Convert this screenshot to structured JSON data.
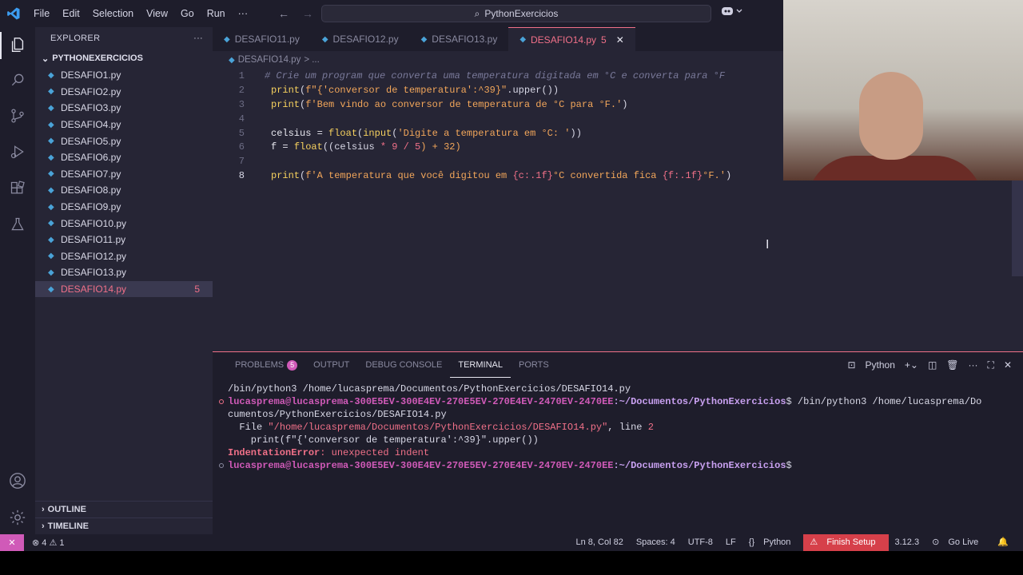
{
  "titlebar": {
    "menu": [
      "File",
      "Edit",
      "Selection",
      "View",
      "Go",
      "Run",
      "···"
    ],
    "search": "PythonExercicios"
  },
  "sidebar": {
    "title": "EXPLORER",
    "folder": "PYTHONEXERCICIOS",
    "files": [
      {
        "name": "DESAFIO1.py"
      },
      {
        "name": "DESAFIO2.py"
      },
      {
        "name": "DESAFIO3.py"
      },
      {
        "name": "DESAFIO4.py"
      },
      {
        "name": "DESAFIO5.py"
      },
      {
        "name": "DESAFIO6.py"
      },
      {
        "name": "DESAFIO7.py"
      },
      {
        "name": "DESAFIO8.py"
      },
      {
        "name": "DESAFIO9.py"
      },
      {
        "name": "DESAFIO10.py"
      },
      {
        "name": "DESAFIO11.py"
      },
      {
        "name": "DESAFIO12.py"
      },
      {
        "name": "DESAFIO13.py"
      },
      {
        "name": "DESAFIO14.py",
        "badge": "5"
      }
    ],
    "outline": "OUTLINE",
    "timeline": "TIMELINE"
  },
  "tabs": [
    {
      "label": "DESAFIO11.py"
    },
    {
      "label": "DESAFIO12.py"
    },
    {
      "label": "DESAFIO13.py"
    },
    {
      "label": "DESAFIO14.py",
      "badge": "5"
    }
  ],
  "breadcrumb": {
    "file": "DESAFIO14.py",
    "rest": "> ..."
  },
  "editor": {
    "line_numbers": [
      "1",
      "2",
      "3",
      "4",
      "5",
      "6",
      "7",
      "8"
    ],
    "line1": "# Crie um program que converta uma temperatura digitada em °C e converta para °F",
    "line2_str": "f\"{'conversor de temperatura':^39}\"",
    "line2_tail": ".upper())",
    "line3_str": "f'Bem vindo ao conversor de temperatura de °C para °F.'",
    "line5_a": "celsius = ",
    "line5_str": "'Digite a temperatura em °C: '",
    "line6_a": "f = ",
    "line6_b": "((celsius ",
    "line6_c": "* 9 / 5",
    "line6_d": ") + 32)",
    "line8_str1": "f'A temperatura que você digitou em ",
    "line8_brace1": "{c:.1f}",
    "line8_str2": "°C convertida fica ",
    "line8_brace2": "{f:.1f}",
    "line8_str3": "°F.'",
    "kw_print": "print",
    "kw_float": "float",
    "kw_input": "input"
  },
  "panel": {
    "tabs": [
      "PROBLEMS",
      "OUTPUT",
      "DEBUG CONSOLE",
      "TERMINAL",
      "PORTS"
    ],
    "problems_count": "5",
    "terminal_name": "Python",
    "lines": {
      "l1": "/bin/python3 /home/lucasprema/Documentos/PythonExercicios/DESAFIO14.py",
      "prompt": "lucasprema@lucasprema-300E5EV-300E4EV-270E5EV-270E4EV-2470EV-2470EE",
      "path": ":~/Documentos/PythonExercicios",
      "cmd": "$ /bin/python3 /home/lucasprema/Do",
      "l3": "cumentos/PythonExercicios/DESAFIO14.py",
      "file_pre": "  File ",
      "file_str": "\"/home/lucasprema/Documentos/PythonExercicios/DESAFIO14.py\"",
      "file_post": ", line ",
      "line_no": "2",
      "l5": "    print(f\"{'conversor de temperatura':^39}\".upper())",
      "err_name": "IndentationError",
      "err_msg": ": unexpected indent",
      "end": "$"
    }
  },
  "statusbar": {
    "errors": "⊗ 4 ⚠ 1",
    "position": "Ln 8, Col 82",
    "spaces": "Spaces: 4",
    "encoding": "UTF-8",
    "eol": "LF",
    "language": "Python",
    "finish": "Finish Setup",
    "version": "3.12.3",
    "golive": "Go Live"
  },
  "colors": {
    "accent": "#f07088",
    "badge": "#d05ab8"
  }
}
